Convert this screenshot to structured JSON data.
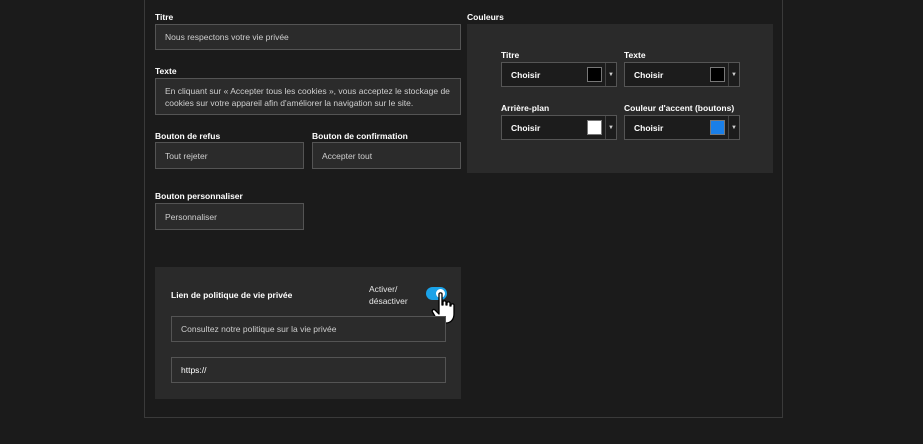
{
  "form": {
    "title_label": "Titre",
    "title_value": "Nous respectons votre vie privée",
    "text_label": "Texte",
    "text_value": "En cliquant sur « Accepter tous les cookies », vous acceptez le stockage de cookies sur votre appareil afin d'améliorer la navigation sur le site.",
    "refuse_label": "Bouton de refus",
    "refuse_value": "Tout rejeter",
    "confirm_label": "Bouton de confirmation",
    "confirm_value": "Accepter tout",
    "customize_label": "Bouton personnaliser",
    "customize_value": "Personnaliser"
  },
  "privacy": {
    "label": "Lien de politique de vie privée",
    "toggle_label_line1": "Activer/",
    "toggle_label_line2": "désactiver",
    "toggle_on": true,
    "link_text_value": "Consultez notre politique sur la vie privée",
    "url_value": "https://"
  },
  "colors": {
    "section_label": "Couleurs",
    "choose_label": "Choisir",
    "title": {
      "label": "Titre",
      "color": "#000000"
    },
    "text": {
      "label": "Texte",
      "color": "#000000"
    },
    "background": {
      "label": "Arrière-plan",
      "color": "#ffffff"
    },
    "accent": {
      "label": "Couleur d'accent (boutons)",
      "color": "#1a7fe8"
    }
  }
}
